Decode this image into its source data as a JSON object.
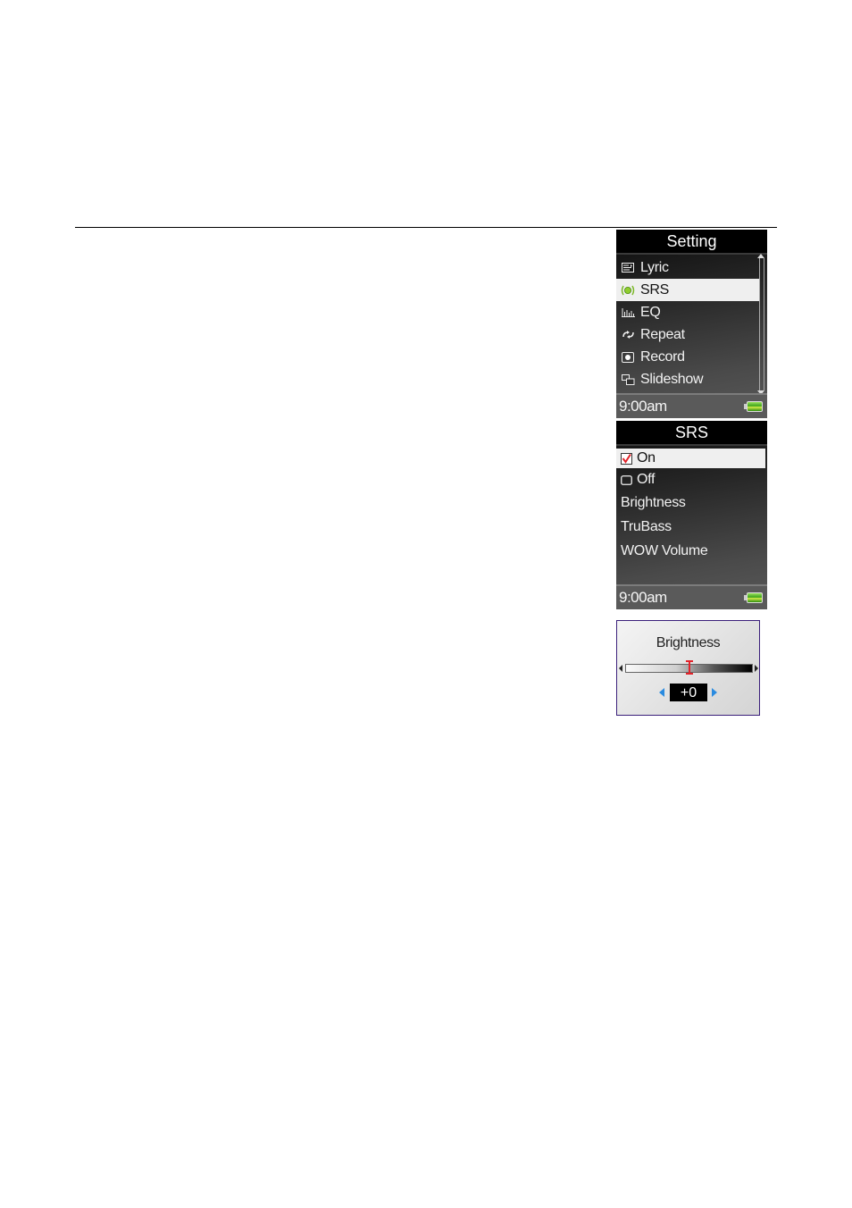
{
  "setting_screen": {
    "title": "Setting",
    "items": [
      {
        "label": "Lyric",
        "icon": "lyric-icon"
      },
      {
        "label": "SRS",
        "icon": "srs-icon",
        "selected": true
      },
      {
        "label": "EQ",
        "icon": "eq-icon"
      },
      {
        "label": "Repeat",
        "icon": "repeat-icon"
      },
      {
        "label": "Record",
        "icon": "record-icon"
      },
      {
        "label": "Slideshow",
        "icon": "slideshow-icon"
      }
    ],
    "status_time": "9:00am"
  },
  "srs_screen": {
    "title": "SRS",
    "items": [
      {
        "label": "On",
        "checked": true
      },
      {
        "label": "Off",
        "checked": false
      },
      {
        "label": "Brightness"
      },
      {
        "label": "TruBass"
      },
      {
        "label": "WOW Volume"
      }
    ],
    "status_time": "9:00am"
  },
  "brightness_dialog": {
    "title": "Brightness",
    "value_label": "+0",
    "slider_fraction": 0.5
  },
  "colors": {
    "selection_bg": "#efefef",
    "accent_red": "#e2232a",
    "accent_blue": "#2a8be0",
    "battery_green": "#3aa31a",
    "dialog_border": "#3a1f7a"
  }
}
